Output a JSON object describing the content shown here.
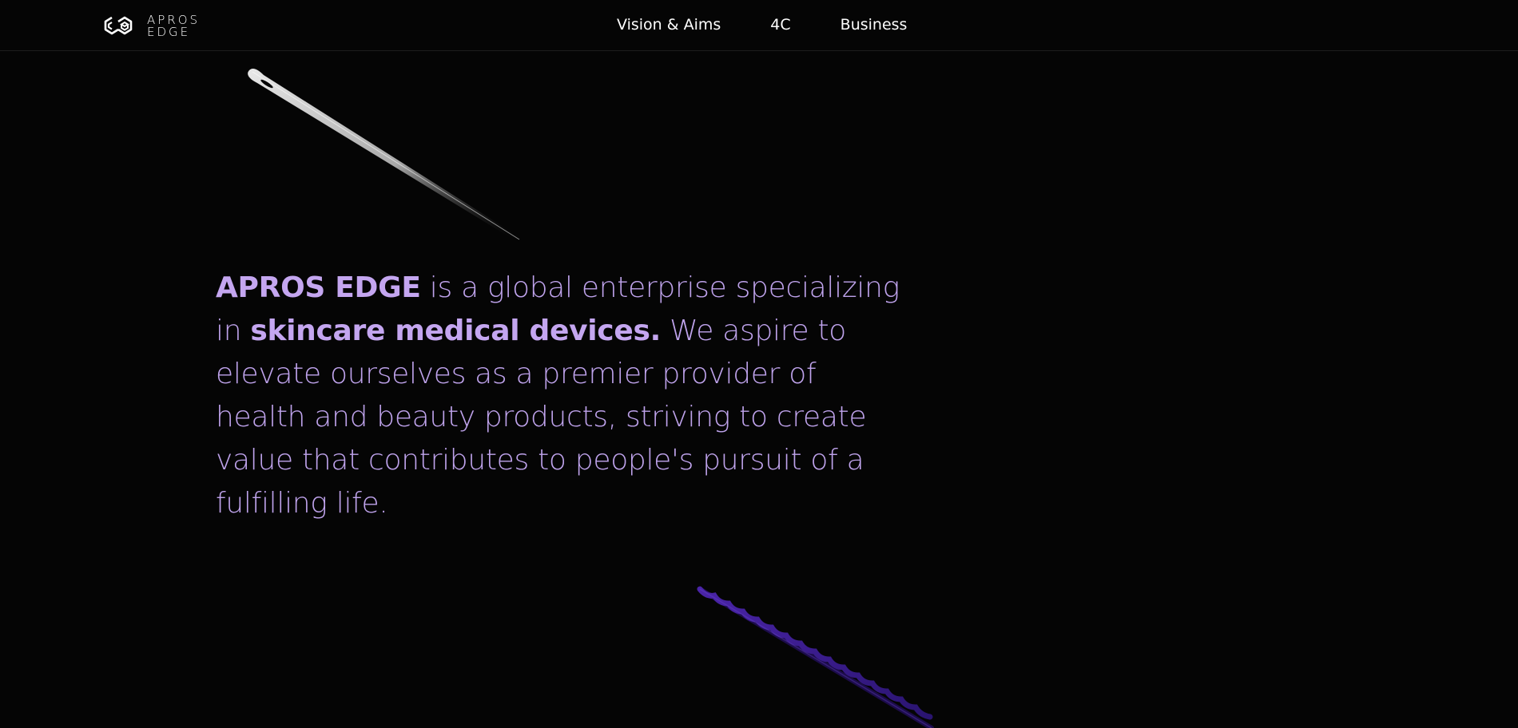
{
  "brand": {
    "logo_line1": "APROS",
    "logo_line2": "EDGE",
    "icon": "apros-edge-logo-icon"
  },
  "nav": {
    "items": [
      {
        "label": "Vision & Aims"
      },
      {
        "label": "4C"
      },
      {
        "label": "Business"
      }
    ]
  },
  "hero": {
    "brand_name": "APROS EDGE",
    "text1": " is a global enterprise specializing in ",
    "highlight": "skincare medical devices.",
    "text2": " We aspire to elevate ourselves as a premier provider of health and beauty products, striving to create value that contributes to people's pursuit of a fulfilling life."
  },
  "colors": {
    "background": "#050505",
    "accent": "#bfa3ec",
    "nav_text": "#ffffff",
    "thread": "#3a1c8c"
  },
  "decor": {
    "needle": "silver-needle-image",
    "thread": "purple-thread-needle-image"
  }
}
